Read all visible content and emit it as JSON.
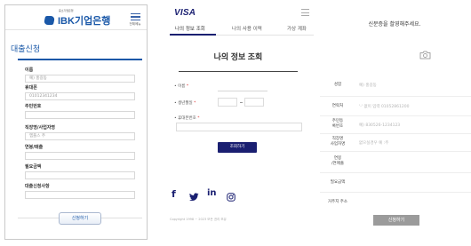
{
  "ibk": {
    "logo_sub": "중소기업은행",
    "logo_text": "IBK기업은행",
    "menu_label": "전체메뉴",
    "title": "대출신청",
    "fields": [
      {
        "label": "이름",
        "value": "예) 홍길동"
      },
      {
        "label": "휴대폰",
        "value": "01012341234"
      },
      {
        "label": "주민번호",
        "value": ""
      },
      {
        "label": "직장명/사업자명",
        "value": "엠플스 주"
      },
      {
        "label": "연봉/매출",
        "value": ""
      },
      {
        "label": "필요금액",
        "value": ""
      },
      {
        "label": "대출신청사항",
        "value": ""
      }
    ],
    "submit_label": "신청하기",
    "accent": "#1a58a8"
  },
  "visa": {
    "logo": "VISA",
    "tabs": [
      "나의 정보 조회",
      "나의 사용 이력",
      "가상 계좌"
    ],
    "heading": "나의 정보 조회",
    "fields": [
      {
        "label": "이름",
        "required": "*"
      },
      {
        "label": "생년월일",
        "required": "*"
      },
      {
        "label": "휴대폰번호",
        "required": "*"
      }
    ],
    "submit_label": "조회하기",
    "social_icons": [
      "facebook-icon",
      "twitter-icon",
      "linkedin-icon",
      "instagram-icon"
    ],
    "social_glyphs": [
      "f",
      "🐦",
      "in",
      "◎"
    ],
    "copyright": "Copyright 1998 ~ 2023 모든 권리 보유",
    "accent": "#1a1f71"
  },
  "idcard": {
    "instruction": "신분증을 촬영해주세요.",
    "rows": [
      {
        "label": "성함",
        "value": "예) 홍길동"
      },
      {
        "label": "연락처",
        "value": "'-' 없이 입력 01052861200"
      },
      {
        "label": "주민등\n록번호",
        "value": "예) 830526-1234123"
      },
      {
        "label": "직장명\n사업자명",
        "value": "없으실경우 예 :주"
      },
      {
        "label": "연봉\n/연매출",
        "value": ""
      },
      {
        "label": "필요금액",
        "value": ""
      },
      {
        "label": "거주지 주소",
        "value": ""
      }
    ],
    "submit_label": "신청하기"
  }
}
